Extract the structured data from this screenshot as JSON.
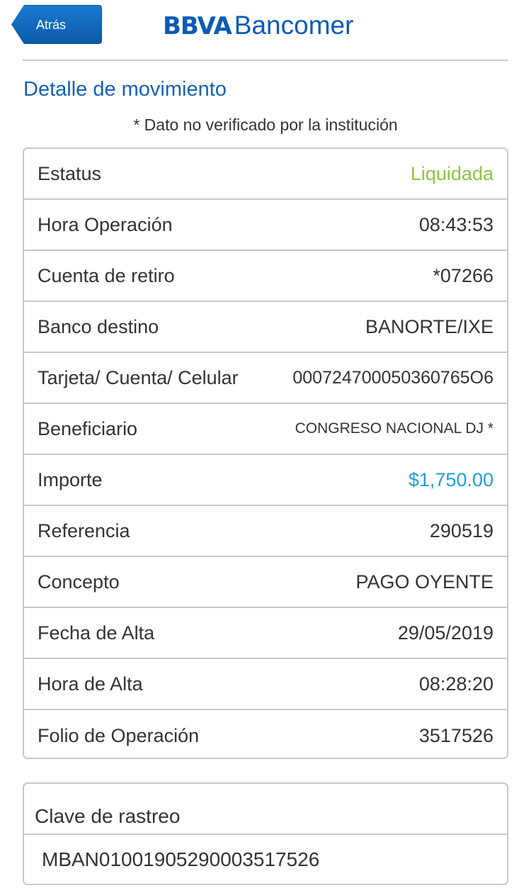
{
  "header": {
    "back_label": "Atrás",
    "brand_bold": "BBVA",
    "brand_light": "Bancomer"
  },
  "page_title": "Detalle de movimiento",
  "note": "* Dato no verificado por la institución",
  "details": [
    {
      "label": "Estatus",
      "value": "Liquidada",
      "value_color": "#8cc63f"
    },
    {
      "label": "Hora Operación",
      "value": "08:43:53"
    },
    {
      "label": "Cuenta de retiro",
      "value": "*07266"
    },
    {
      "label": "Banco destino",
      "value": "BANORTE/IXE"
    },
    {
      "label": "Tarjeta/ Cuenta/ Celular",
      "value": "000724700050360765O6"
    },
    {
      "label": "Beneficiario",
      "value": "CONGRESO NACIONAL DJ *"
    },
    {
      "label": "Importe",
      "value": "$1,750.00",
      "value_color": "#1ea0dd"
    },
    {
      "label": "Referencia",
      "value": "290519"
    },
    {
      "label": "Concepto",
      "value": "PAGO OYENTE"
    },
    {
      "label": "Fecha de Alta",
      "value": "29/05/2019"
    },
    {
      "label": "Hora de Alta",
      "value": "08:28:20"
    },
    {
      "label": "Folio de Operación",
      "value": "3517526"
    }
  ],
  "tracking": {
    "label": "Clave de rastreo",
    "value": "MBAN01001905290003517526"
  },
  "colors": {
    "brand_blue": "#0a5bb5",
    "title_blue": "#1660b4",
    "status_green": "#8cc63f",
    "amount_blue": "#1ea0dd",
    "border_gray": "#c8c8c8"
  }
}
